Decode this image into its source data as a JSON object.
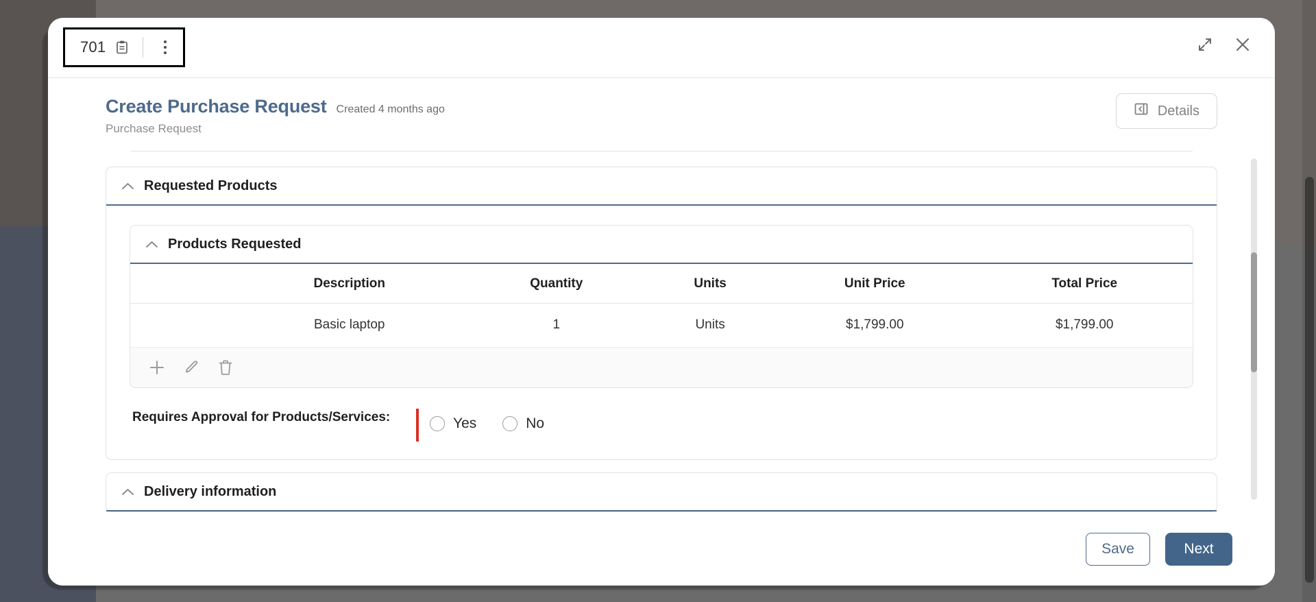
{
  "titlebar": {
    "record_number": "701",
    "clipboard_icon": "clipboard-icon",
    "kebab_icon": "more-options-icon",
    "expand_icon": "expand-icon",
    "close_icon": "close-icon"
  },
  "header": {
    "title": "Create Purchase Request",
    "created": "Created 4 months ago",
    "subtitle": "Purchase Request",
    "details_label": "Details",
    "details_icon": "panel-collapse-icon"
  },
  "sections": {
    "requested_products": {
      "title": "Requested Products",
      "collapse_icon": "chevron-up-icon"
    },
    "products_requested": {
      "title": "Products Requested",
      "collapse_icon": "chevron-up-icon"
    },
    "delivery_information": {
      "title": "Delivery information",
      "collapse_icon": "chevron-up-icon"
    }
  },
  "table": {
    "columns": [
      "",
      "Description",
      "Quantity",
      "Units",
      "Unit Price",
      "Total Price"
    ],
    "rows": [
      [
        "",
        "Basic laptop",
        "1",
        "Units",
        "$1,799.00",
        "$1,799.00"
      ]
    ],
    "actions": {
      "add_icon": "plus-icon",
      "edit_icon": "pencil-icon",
      "delete_icon": "trash-icon"
    }
  },
  "approval_field": {
    "label": "Requires Approval for Products/Services:",
    "required": true,
    "options": [
      {
        "label": "Yes",
        "selected": false
      },
      {
        "label": "No",
        "selected": false
      }
    ]
  },
  "footer": {
    "save_label": "Save",
    "next_label": "Next"
  },
  "colors": {
    "accent": "#44658a",
    "title": "#4d6a8c",
    "required": "#d93025",
    "section_rule": "#4f6a8b"
  }
}
